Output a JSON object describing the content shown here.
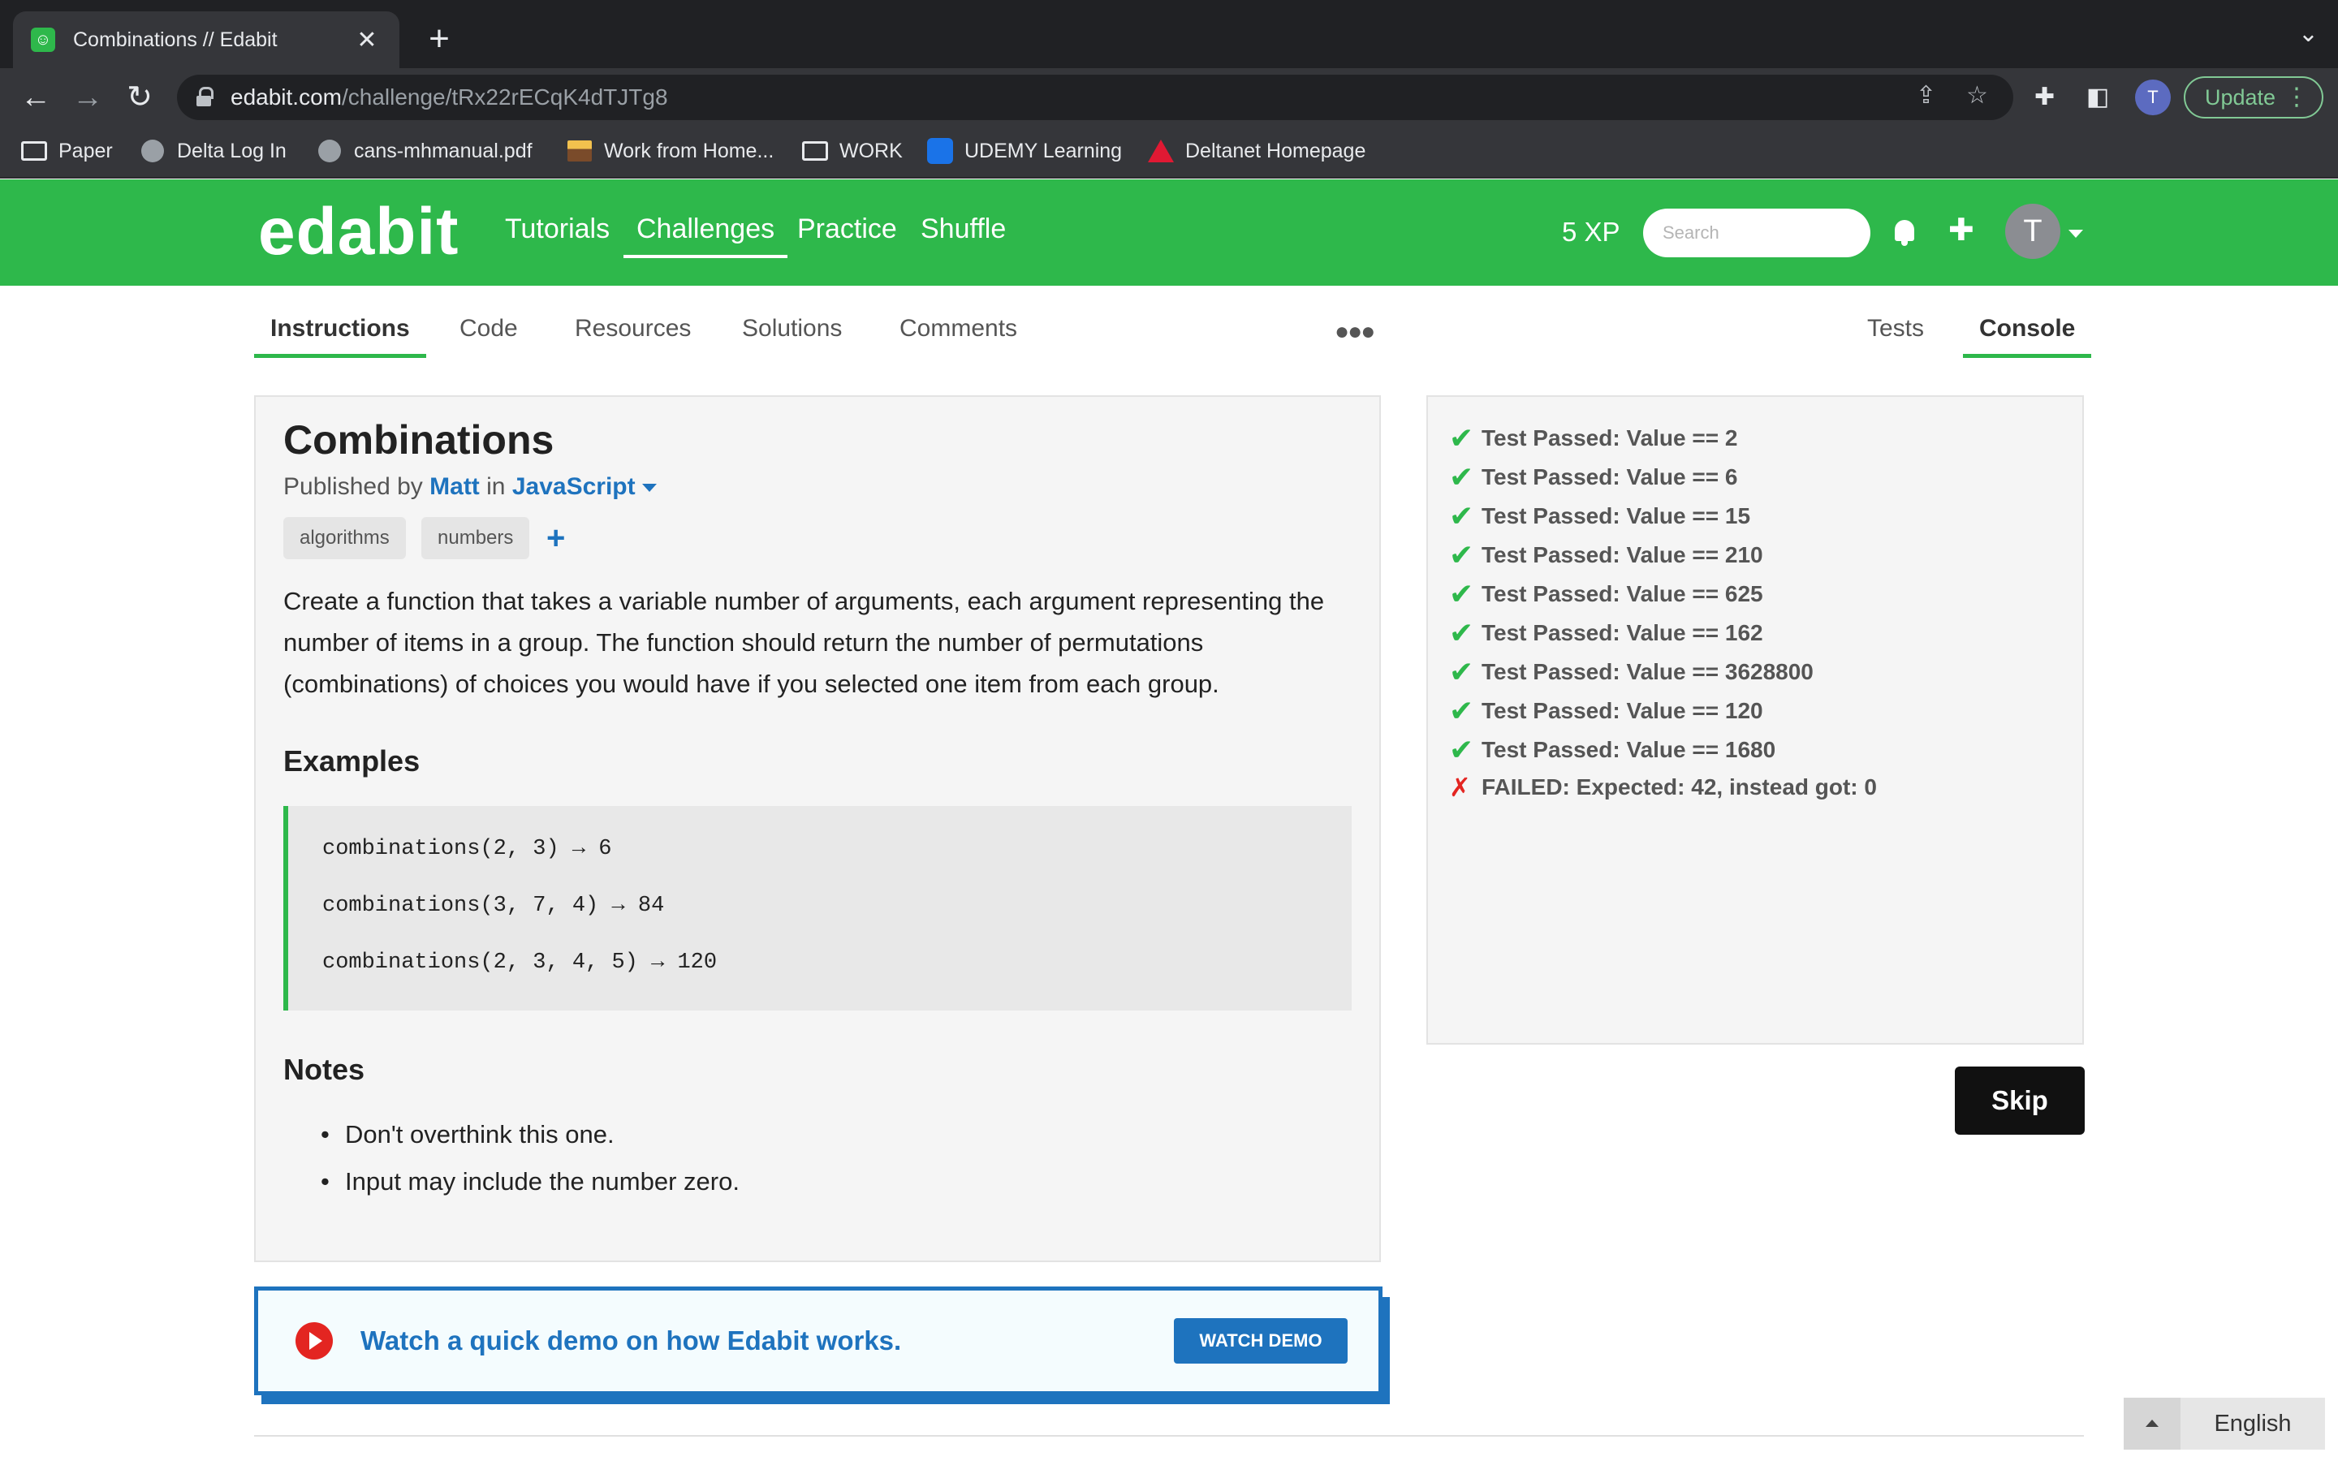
{
  "browser": {
    "tab_title": "Combinations // Edabit",
    "tab_favicon": "edabit-favicon",
    "url_host": "edabit.com",
    "url_path": "/challenge/tRx22rECqK4dTJTg8",
    "profile_initial": "T",
    "update_label": "Update",
    "bookmarks": [
      {
        "label": "Paper",
        "icon": "folder-icon"
      },
      {
        "label": "Delta Log In",
        "icon": "globe-icon"
      },
      {
        "label": "cans-mhmanual.pdf",
        "icon": "globe-icon"
      },
      {
        "label": "Work from Home...",
        "icon": "work-favicon"
      },
      {
        "label": "WORK",
        "icon": "folder-icon"
      },
      {
        "label": "UDEMY Learning",
        "icon": "udemy-favicon"
      },
      {
        "label": "Deltanet Homepage",
        "icon": "delta-favicon"
      }
    ]
  },
  "header": {
    "logo": "edabit",
    "nav": [
      "Tutorials",
      "Challenges",
      "Practice",
      "Shuffle"
    ],
    "active_nav": "Challenges",
    "xp": "5 XP",
    "search_placeholder": "Search",
    "avatar_initial": "T",
    "brand_color": "#2eb84b"
  },
  "subtabs": {
    "left": [
      "Instructions",
      "Code",
      "Resources",
      "Solutions",
      "Comments"
    ],
    "right": [
      "Tests",
      "Console"
    ],
    "active_left": "Instructions",
    "active_right": "Console"
  },
  "challenge": {
    "title": "Combinations",
    "published_prefix": "Published by",
    "author": "Matt",
    "in_word": "in",
    "language": "JavaScript",
    "tags": [
      "algorithms",
      "numbers"
    ],
    "description": "Create a function that takes a variable number of arguments, each argument representing the number of items in a group. The function should return the number of permutations (combinations) of choices you would have if you selected one item from each group.",
    "examples_heading": "Examples",
    "examples": [
      "combinations(2, 3) → 6",
      "combinations(3, 7, 4) → 84",
      "combinations(2, 3, 4, 5) → 120"
    ],
    "notes_heading": "Notes",
    "notes": [
      "Don't overthink this one.",
      "Input may include the number zero."
    ]
  },
  "demo": {
    "text": "Watch a quick demo on how Edabit works.",
    "button": "WATCH DEMO"
  },
  "console": {
    "results": [
      {
        "status": "pass",
        "text": "Test Passed: Value == 2"
      },
      {
        "status": "pass",
        "text": "Test Passed: Value == 6"
      },
      {
        "status": "pass",
        "text": "Test Passed: Value == 15"
      },
      {
        "status": "pass",
        "text": "Test Passed: Value == 210"
      },
      {
        "status": "pass",
        "text": "Test Passed: Value == 625"
      },
      {
        "status": "pass",
        "text": "Test Passed: Value == 162"
      },
      {
        "status": "pass",
        "text": "Test Passed: Value == 3628800"
      },
      {
        "status": "pass",
        "text": "Test Passed: Value == 120"
      },
      {
        "status": "pass",
        "text": "Test Passed: Value == 1680"
      },
      {
        "status": "fail",
        "text": "FAILED: Expected: 42, instead got: 0"
      }
    ],
    "pass_mark": "✔",
    "fail_mark": "✗"
  },
  "skip_label": "Skip",
  "language_selector": "English"
}
